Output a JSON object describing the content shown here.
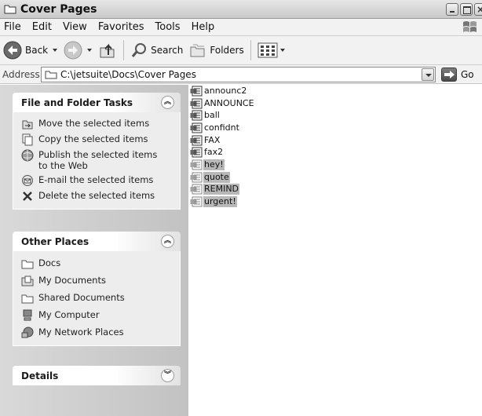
{
  "window": {
    "title": "Cover Pages"
  },
  "menu": [
    "File",
    "Edit",
    "View",
    "Favorites",
    "Tools",
    "Help"
  ],
  "toolbar": {
    "back": "Back",
    "search": "Search",
    "folders": "Folders"
  },
  "address": {
    "label": "Address",
    "path": "C:\\jetsuite\\Docs\\Cover Pages",
    "go": "Go"
  },
  "tasks_panel": {
    "title": "File and Folder Tasks",
    "items": [
      {
        "label": "Move the selected items",
        "icon": "move-icon"
      },
      {
        "label": "Copy the selected items",
        "icon": "copy-icon"
      },
      {
        "label": "Publish the selected items to the Web",
        "icon": "publish-web-icon"
      },
      {
        "label": "E-mail the selected items",
        "icon": "email-icon"
      },
      {
        "label": "Delete the selected items",
        "icon": "delete-icon"
      }
    ]
  },
  "places_panel": {
    "title": "Other Places",
    "items": [
      {
        "label": "Docs",
        "icon": "folder-icon"
      },
      {
        "label": "My Documents",
        "icon": "my-documents-icon"
      },
      {
        "label": "Shared Documents",
        "icon": "shared-folder-icon"
      },
      {
        "label": "My Computer",
        "icon": "computer-icon"
      },
      {
        "label": "My Network Places",
        "icon": "network-icon"
      }
    ]
  },
  "details_panel": {
    "title": "Details"
  },
  "files": [
    {
      "name": "announc2",
      "selected": false
    },
    {
      "name": "ANNOUNCE",
      "selected": false
    },
    {
      "name": "ball",
      "selected": false
    },
    {
      "name": "confidnt",
      "selected": false
    },
    {
      "name": "FAX",
      "selected": false
    },
    {
      "name": "fax2",
      "selected": false
    },
    {
      "name": "hey!",
      "selected": true
    },
    {
      "name": "quote",
      "selected": true
    },
    {
      "name": "REMIND",
      "selected": true
    },
    {
      "name": "urgent!",
      "selected": true
    }
  ]
}
